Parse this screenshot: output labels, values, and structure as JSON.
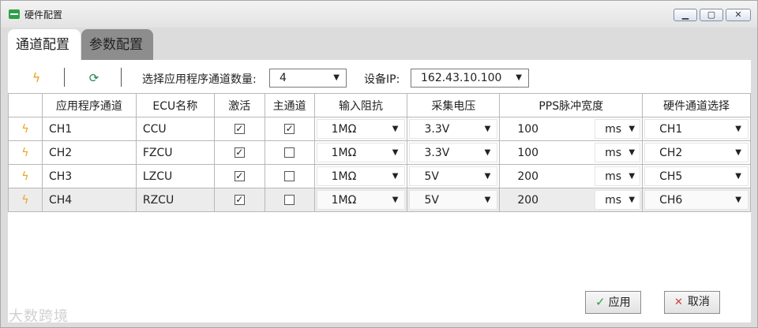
{
  "window": {
    "title": "硬件配置",
    "controls": {
      "minimize": "▁",
      "maximize": "▢",
      "close": "✕"
    }
  },
  "tabs": [
    {
      "label": "通道配置",
      "active": true
    },
    {
      "label": "参数配置",
      "active": false
    }
  ],
  "toolbar": {
    "icons": [
      "lightning-icon",
      "refresh-icon"
    ],
    "channel_count_label": "选择应用程序通道数量:",
    "channel_count_value": "4",
    "device_ip_label": "设备IP:",
    "device_ip_value": "162.43.10.100"
  },
  "table": {
    "headers": [
      "应用程序通道",
      "ECU名称",
      "激活",
      "主通道",
      "输入阻抗",
      "采集电压",
      "PPS脉冲宽度",
      "硬件通道选择"
    ],
    "rows": [
      {
        "channel": "CH1",
        "ecu": "CCU",
        "active": true,
        "main": true,
        "impedance": "1MΩ",
        "voltage": "3.3V",
        "pps": "100",
        "unit": "ms",
        "hw_channel": "CH1"
      },
      {
        "channel": "CH2",
        "ecu": "FZCU",
        "active": true,
        "main": false,
        "impedance": "1MΩ",
        "voltage": "3.3V",
        "pps": "100",
        "unit": "ms",
        "hw_channel": "CH2"
      },
      {
        "channel": "CH3",
        "ecu": "LZCU",
        "active": true,
        "main": false,
        "impedance": "1MΩ",
        "voltage": "5V",
        "pps": "200",
        "unit": "ms",
        "hw_channel": "CH5"
      },
      {
        "channel": "CH4",
        "ecu": "RZCU",
        "active": true,
        "main": false,
        "impedance": "1MΩ",
        "voltage": "5V",
        "pps": "200",
        "unit": "ms",
        "hw_channel": "CH6"
      }
    ]
  },
  "buttons": {
    "apply": "应用",
    "cancel": "取消"
  },
  "watermark": "大数跨境",
  "colors": {
    "bolt": "#f0a020",
    "accent_green": "#2e9e3e",
    "cancel_red": "#d23c3c"
  }
}
